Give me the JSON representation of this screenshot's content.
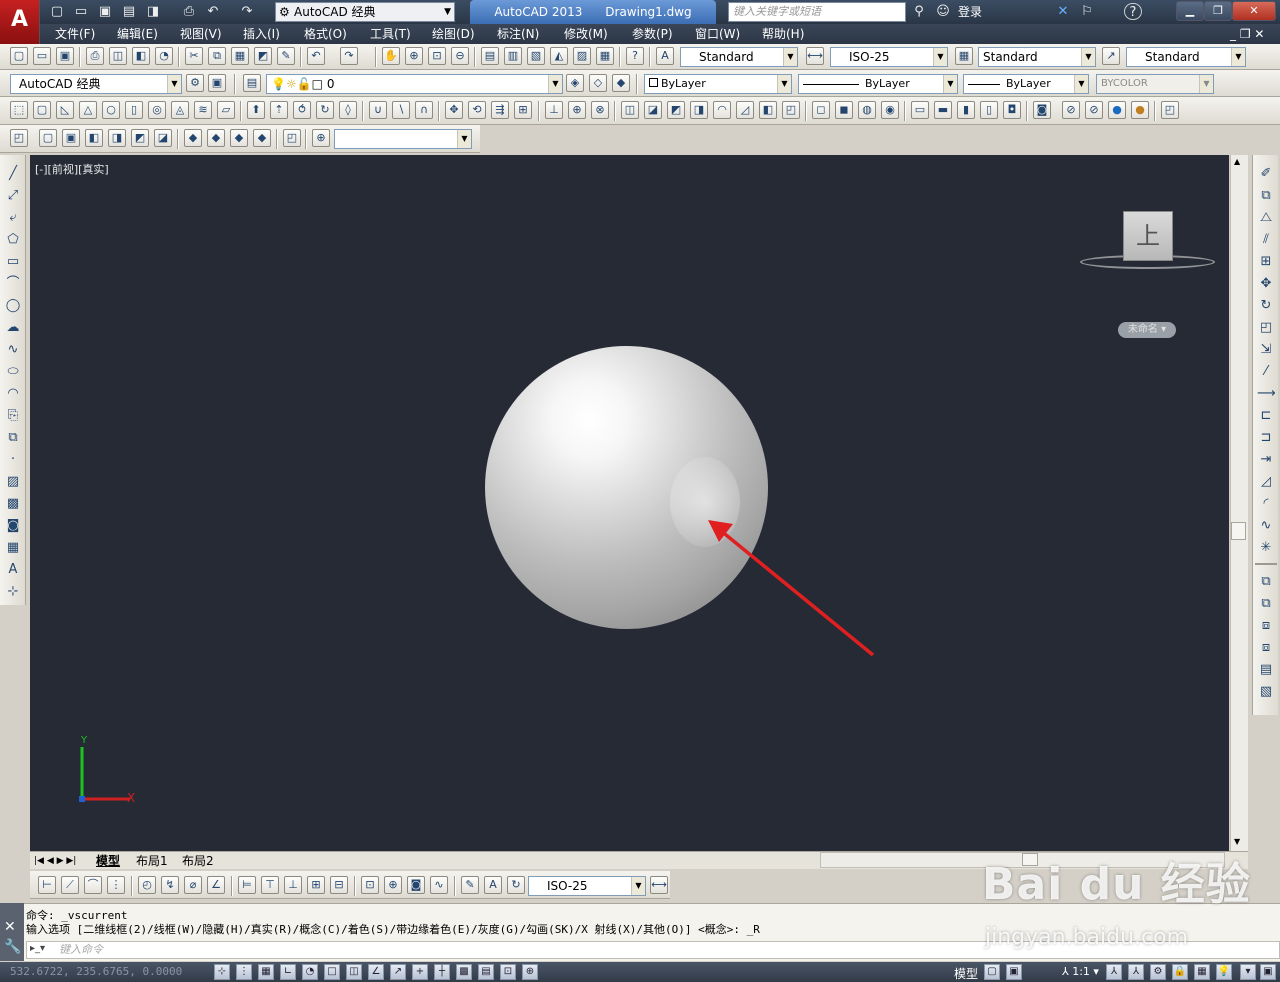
{
  "app": {
    "logo_letter": "A",
    "workspace_name": "AutoCAD 经典",
    "title_app": "AutoCAD 2013",
    "title_file": "Drawing1.dwg",
    "search_placeholder": "键入关键字或短语",
    "login_label": "登录",
    "help_label": "?"
  },
  "menu": [
    "文件(F)",
    "编辑(E)",
    "视图(V)",
    "插入(I)",
    "格式(O)",
    "工具(T)",
    "绘图(D)",
    "标注(N)",
    "修改(M)",
    "参数(P)",
    "窗口(W)",
    "帮助(H)"
  ],
  "styles": {
    "text_style": "Standard",
    "dim_style": "ISO-25",
    "table_style": "Standard",
    "multileader_style": "Standard"
  },
  "layers": {
    "workspace": "AutoCAD 经典",
    "current_layer": "0",
    "color": "ByLayer",
    "linetype": "ByLayer",
    "lineweight": "ByLayer",
    "plot_style": "BYCOLOR"
  },
  "viewport": {
    "label": "[-][前视][真实]",
    "viewcube_face": "上",
    "named_view": "未命名 ▾",
    "ucs_x": "X",
    "ucs_y": "Y"
  },
  "tabs": {
    "model": "模型",
    "layout1": "布局1",
    "layout2": "布局2"
  },
  "dim_toolbar": {
    "dim_style": "ISO-25"
  },
  "command": {
    "line1": "命令: _vscurrent",
    "line2": "输入选项 [二维线框(2)/线框(W)/隐藏(H)/真实(R)/概念(C)/着色(S)/带边缘着色(E)/灰度(G)/勾画(SK)/X 射线(X)/其他(O)] <概念>: _R",
    "input_placeholder": "键入命令"
  },
  "status": {
    "coords": "532.6722, 235.6765, 0.0000",
    "model_label": "模型",
    "scale": "1:1"
  },
  "watermark": {
    "brand": "Bai du 经验",
    "url": "jingyan.baidu.com"
  },
  "colors": {
    "canvas_bg": "#252a35",
    "arrow": "#e02020",
    "ucs_x": "#d02020",
    "ucs_y": "#20c020"
  }
}
